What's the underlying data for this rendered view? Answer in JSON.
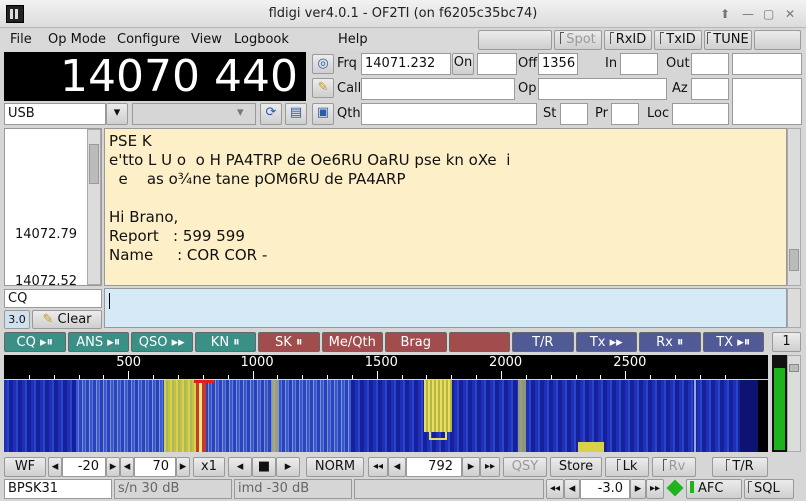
{
  "window": {
    "title": "fldigi ver4.0.1 - OF2TI (on f6205c35bc74)"
  },
  "menu": {
    "file": "File",
    "opmode": "Op Mode",
    "configure": "Configure",
    "view": "View",
    "logbook": "Logbook",
    "help": "Help"
  },
  "topbuttons": {
    "spot": "Spot",
    "rxid": "RxID",
    "txid": "TxID",
    "tune": "TUNE"
  },
  "freq_display": "14070 440",
  "mode": "USB",
  "log": {
    "frq_label": "Frq",
    "frq": "14071.232",
    "on_label": "On",
    "off_label": "Off",
    "off": "1356",
    "in_label": "In",
    "out_label": "Out",
    "call_label": "Call",
    "op_label": "Op",
    "az_label": "Az",
    "qth_label": "Qth",
    "st_label": "St",
    "pr_label": "Pr",
    "loc_label": "Loc"
  },
  "browser": {
    "f1": "14072.79",
    "f2": "14072.52"
  },
  "rx_lines": [
    "PSE K",
    "e'tto L U o  o H PA4TRP de Oe6RU OaRU pse kn oXe  i",
    "  e    as o¾ne tane pOM6RU de PA4ARP",
    "",
    "Hi Brano,",
    "Report   : 599 599",
    "Name     : COR COR -"
  ],
  "cq_input": "CQ",
  "squelch_val": "3.0",
  "clear_label": "Clear",
  "macros": [
    {
      "label": "CQ ▸⏸",
      "color": "#3a8f86"
    },
    {
      "label": "ANS ▸⏸",
      "color": "#3a8f86"
    },
    {
      "label": "QSO ▸▸",
      "color": "#3a8f86"
    },
    {
      "label": "KN ⏸",
      "color": "#3a8f86"
    },
    {
      "label": "SK ⏸",
      "color": "#a24d4d"
    },
    {
      "label": "Me/Qth",
      "color": "#a24d4d"
    },
    {
      "label": "Brag",
      "color": "#a24d4d"
    },
    {
      "label": "",
      "color": "#a24d4d"
    },
    {
      "label": "T/R",
      "color": "#505a96"
    },
    {
      "label": "Tx ▸▸",
      "color": "#505a96"
    },
    {
      "label": "Rx ⏸",
      "color": "#505a96"
    },
    {
      "label": "TX ▸⏸",
      "color": "#505a96"
    }
  ],
  "macro_page": "1",
  "scale": [
    "500",
    "1000",
    "1500",
    "2000",
    "2500"
  ],
  "bottom": {
    "wf": "WF",
    "lo": "-20",
    "hi": "70",
    "x1": "x1",
    "norm": "NORM",
    "freq": "792",
    "qsy": "QSY",
    "store": "Store",
    "lk": "Lk",
    "rv": "Rv",
    "tr": "T/R"
  },
  "status": {
    "mode": "BPSK31",
    "sn": "s/n 30 dB",
    "imd": "imd -30 dB",
    "afc_val": "-3.0",
    "afc": "AFC",
    "sql": "SQL"
  }
}
